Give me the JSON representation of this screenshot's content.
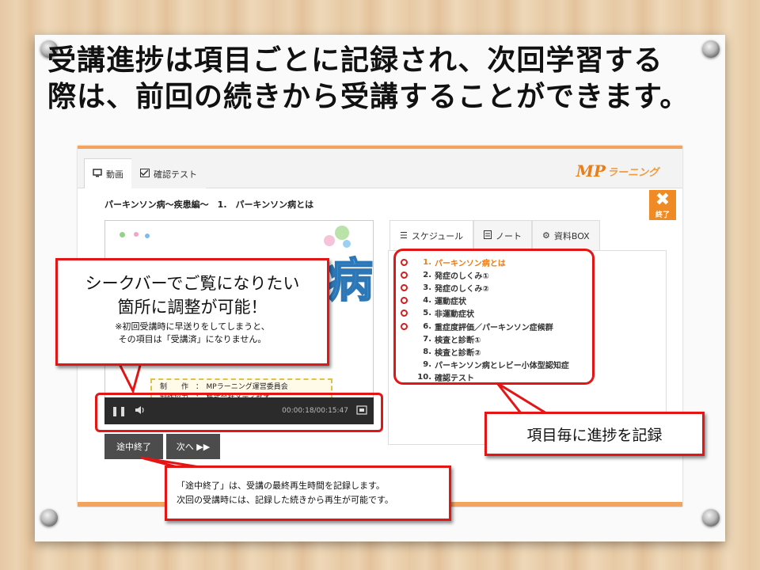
{
  "headline": {
    "line1": "受講進捗は項目ごとに記録され、次回学習する",
    "line2": "際は、前回の続きから受講することができます。"
  },
  "app": {
    "tabs": [
      {
        "icon": "monitor-icon",
        "label": "動画"
      },
      {
        "icon": "checklist-icon",
        "label": "確認テスト"
      }
    ],
    "logo_mark": "MP",
    "logo_text": "ラーニング",
    "lesson_title": "パーキンソン病〜疾患編〜　1.　パーキンソン病とは",
    "end_button": {
      "icon": "close-x-icon",
      "label": "終了"
    },
    "video": {
      "title_glyph": "病",
      "credits": [
        {
          "label": "制　　作",
          "value": "MPラーニング運営委員会"
        },
        {
          "label": "制作協力",
          "value": "株式会社メディセオ"
        }
      ],
      "play_state_icon": "pause-icon",
      "volume_icon": "volume-icon",
      "time": "00:00:18/00:15:47",
      "fullscreen_icon": "fullscreen-icon"
    },
    "buttons": {
      "pause_end": "途中終了",
      "next": "次へ ▶▶"
    },
    "side_tabs": [
      {
        "icon": "list-icon",
        "label": "スケジュール"
      },
      {
        "icon": "note-icon",
        "label": "ノート"
      },
      {
        "icon": "box-icon",
        "label": "資料BOX"
      }
    ],
    "schedule": [
      {
        "num": "1.",
        "label": "パーキンソン病とは",
        "done": true,
        "current": true
      },
      {
        "num": "2.",
        "label": "発症のしくみ①",
        "done": true,
        "current": false
      },
      {
        "num": "3.",
        "label": "発症のしくみ②",
        "done": true,
        "current": false
      },
      {
        "num": "4.",
        "label": "運動症状",
        "done": true,
        "current": false
      },
      {
        "num": "5.",
        "label": "非運動症状",
        "done": true,
        "current": false
      },
      {
        "num": "6.",
        "label": "重症度評価／パーキンソン症候群",
        "done": true,
        "current": false
      },
      {
        "num": "7.",
        "label": "検査と診断①",
        "done": false,
        "current": false
      },
      {
        "num": "8.",
        "label": "検査と診断②",
        "done": false,
        "current": false
      },
      {
        "num": "9.",
        "label": "パーキンソン病とレビー小体型認知症",
        "done": false,
        "current": false
      },
      {
        "num": "10.",
        "label": "確認テスト",
        "done": false,
        "current": false
      }
    ]
  },
  "callouts": {
    "seekbar_line1": "シークバーでご覧になりたい",
    "seekbar_line2": "箇所に調整が可能！",
    "seekbar_note1": "※初回受講時に早送りをしてしまうと、",
    "seekbar_note2": "その項目は「受講済」になりません。",
    "progress": "項目毎に進捗を記録",
    "pause_line1": "「途中終了」は、受講の最終再生時間を記録します。",
    "pause_line2": "次回の受講時には、記録した続きから再生が可能です。"
  },
  "colors": {
    "accent_orange": "#f08a24",
    "callout_red": "#e31515",
    "button_gray": "#4c4c4c"
  }
}
